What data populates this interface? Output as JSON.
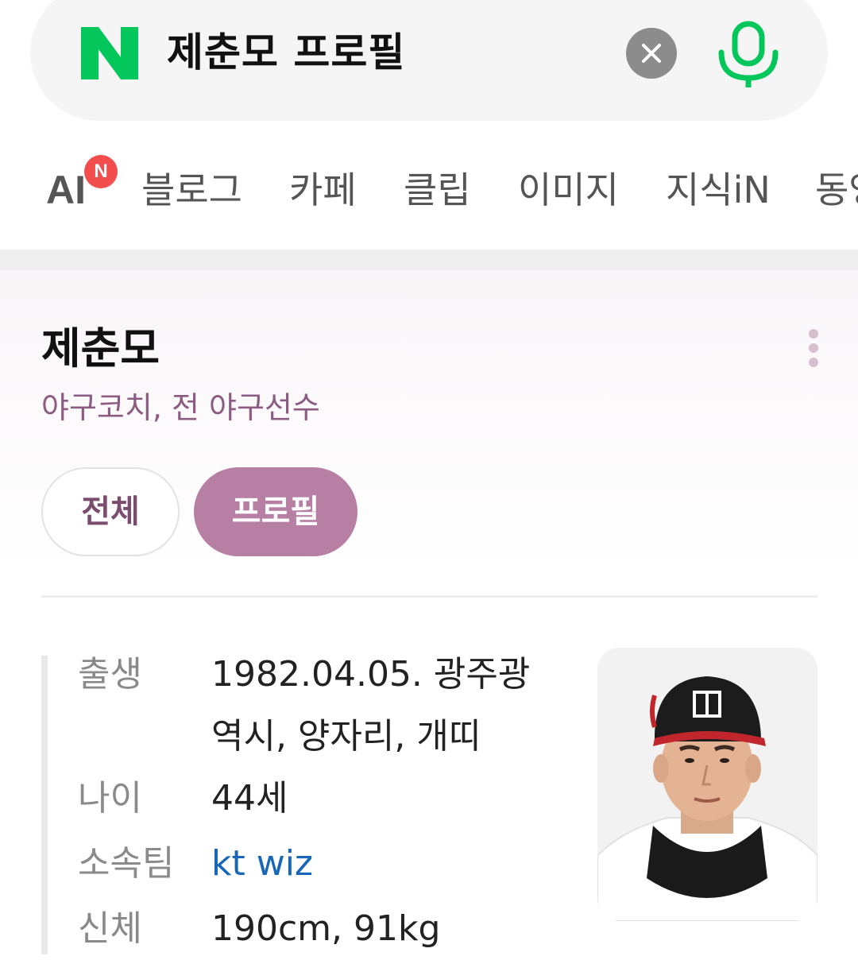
{
  "search": {
    "query": "제춘모 프로필",
    "logo_letter": "N",
    "icons": [
      "naver-n-logo",
      "clear-icon",
      "microphone-icon"
    ],
    "brand_color": "#03c75a"
  },
  "tabs": {
    "ai_label": "AI",
    "ai_badge": "N",
    "items": [
      "블로그",
      "카페",
      "클립",
      "이미지",
      "지식iN",
      "동영"
    ]
  },
  "profile": {
    "name": "제춘모",
    "subtitle": "야구코치, 전 야구선수",
    "filters": [
      "전체",
      "프로필"
    ],
    "active_filter": "프로필",
    "accent_color": "#b77fa4",
    "rows": [
      {
        "label": "출생",
        "value": "1982.04.05. 광주광역시, 양자리, 개띠"
      },
      {
        "label": "나이",
        "value": "44세"
      },
      {
        "label": "소속팀",
        "value": "kt wiz"
      },
      {
        "label": "신체",
        "value": "190cm, 91kg"
      }
    ]
  }
}
